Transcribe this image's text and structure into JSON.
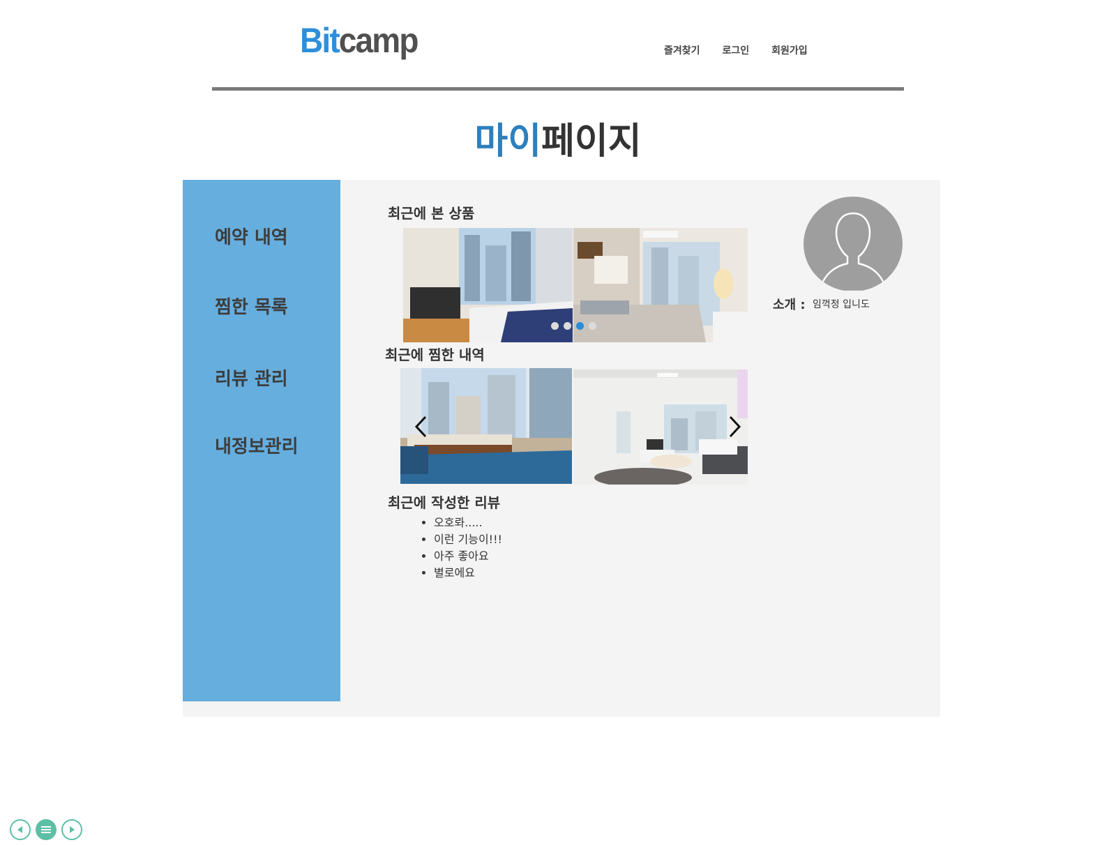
{
  "header": {
    "logo_part1": "Bit",
    "logo_part2": "camp",
    "nav": [
      "즐겨찾기",
      "로그인",
      "회원가입"
    ]
  },
  "title": {
    "accent": "마이",
    "rest": "페이지"
  },
  "sidebar": {
    "items": [
      {
        "label": "예약 내역"
      },
      {
        "label": "찜한 목록"
      },
      {
        "label": "리뷰 관리"
      },
      {
        "label": "내정보관리"
      }
    ]
  },
  "sections": {
    "recent_viewed": "최근에 본 상품",
    "recent_wishlist": "최근에 찜한 내역",
    "recent_reviews": "최근에 작성한 리뷰"
  },
  "carousel": {
    "dot_count": 4,
    "active_dot": 3
  },
  "reviews": [
    "오호롸.....",
    "이런 기능이!!!",
    "아주 좋아요",
    "별로에요"
  ],
  "profile": {
    "intro_label": "소개 :",
    "intro_value": "임꺽정 입니도"
  },
  "colors": {
    "accent": "#2d8fdc",
    "sidebar": "#66aede",
    "panel": "#f4f4f4",
    "rule": "#7a7a7a",
    "dot_active": "#2a8cd6",
    "controls": "#5cbfa6"
  },
  "icons": [
    "user-silhouette-icon",
    "chevron-left-icon",
    "chevron-right-icon",
    "prev-circle-icon",
    "menu-circle-icon",
    "next-circle-icon"
  ]
}
